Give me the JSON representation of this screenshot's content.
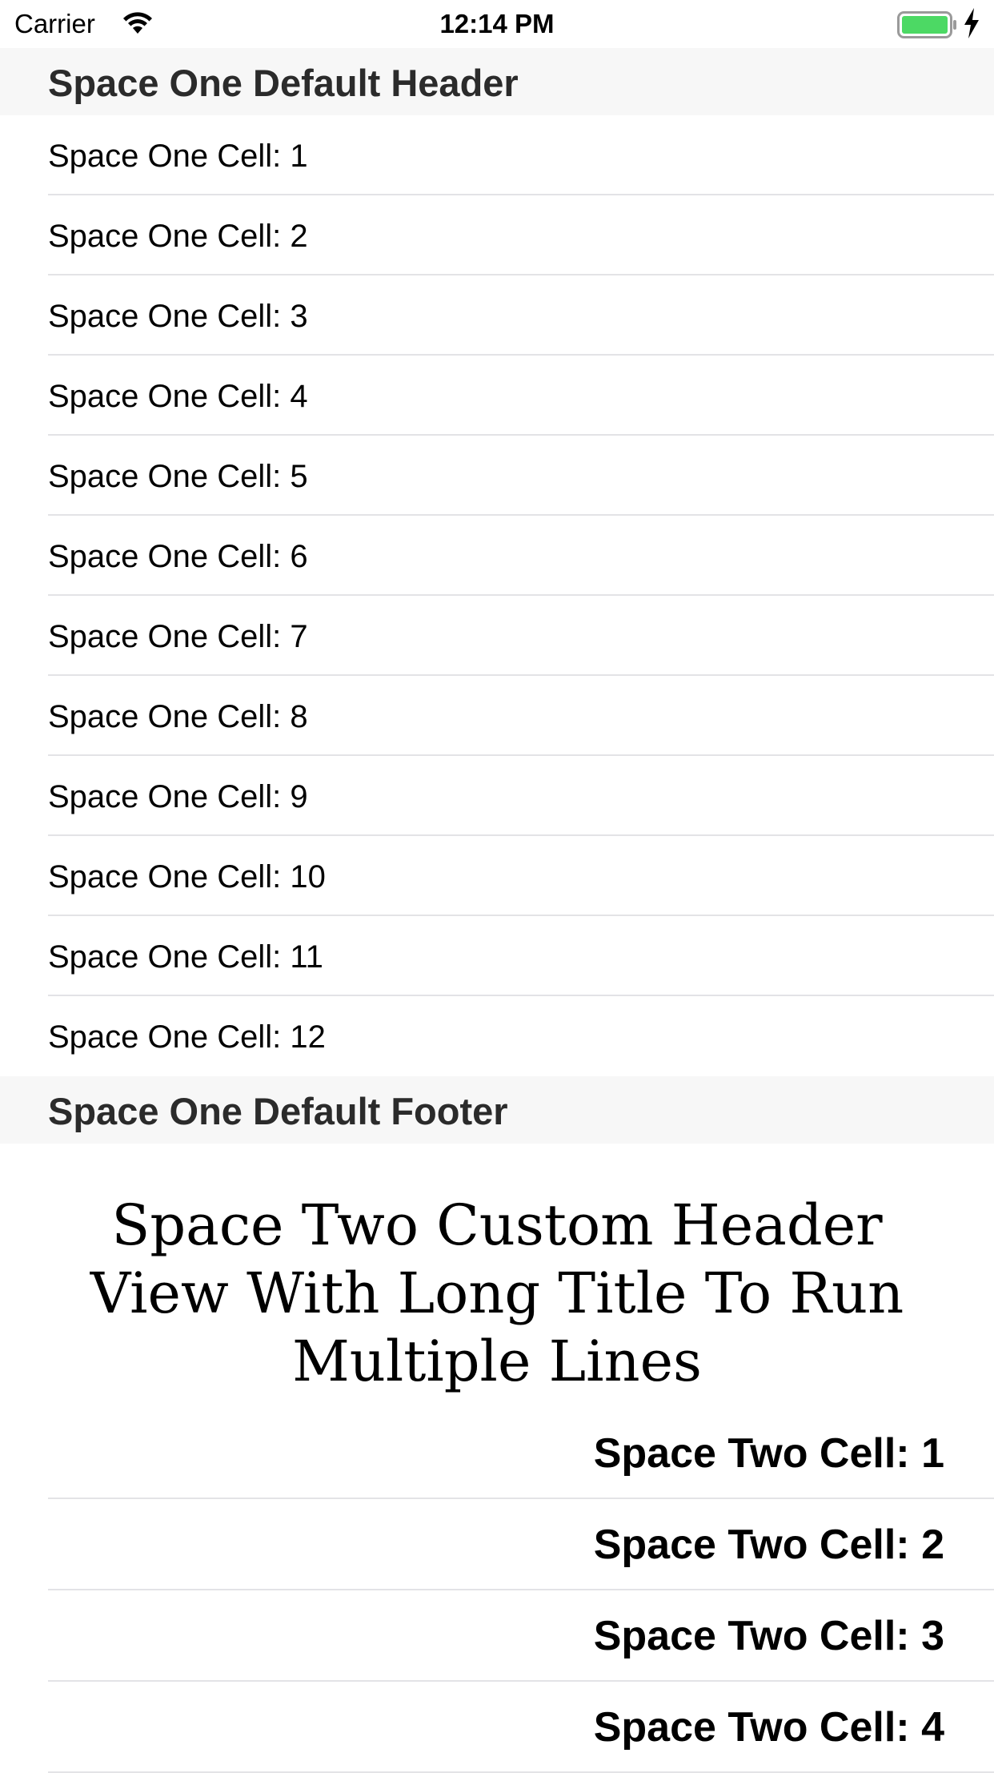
{
  "status_bar": {
    "carrier": "Carrier",
    "time": "12:14 PM",
    "battery_color": "#4cd964"
  },
  "space_one": {
    "header": "Space One Default Header",
    "cells": [
      "Space One Cell: 1",
      "Space One Cell: 2",
      "Space One Cell: 3",
      "Space One Cell: 4",
      "Space One Cell: 5",
      "Space One Cell: 6",
      "Space One Cell: 7",
      "Space One Cell: 8",
      "Space One Cell: 9",
      "Space One Cell: 10",
      "Space One Cell: 11",
      "Space One Cell: 12"
    ],
    "footer": "Space One Default Footer"
  },
  "space_two": {
    "header": "Space Two Custom Header View With Long Title To Run Multiple Lines",
    "cells": [
      "Space Two Cell: 1",
      "Space Two Cell: 2",
      "Space Two Cell: 3",
      "Space Two Cell: 4"
    ]
  }
}
